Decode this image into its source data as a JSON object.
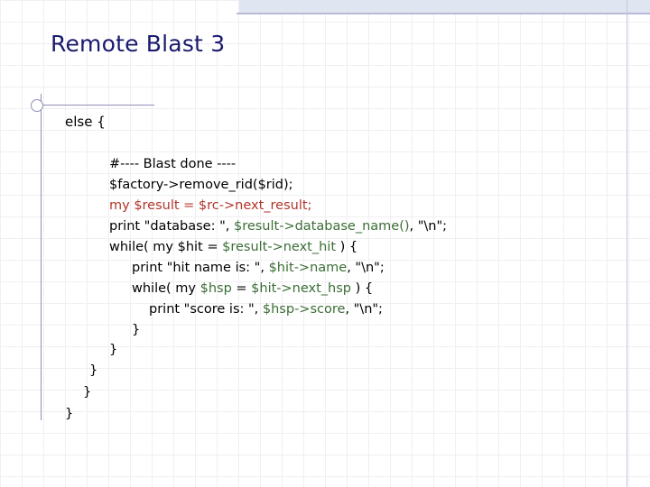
{
  "slide": {
    "title": "Remote Blast 3"
  },
  "code": {
    "else_open": "else {",
    "l1": "#---- Blast done ----",
    "l2": "$factory->remove_rid($rid);",
    "l3": "my $result = $rc->next_result;",
    "l4_a": "print \"database: \", ",
    "l4_b": "$result->database_name()",
    "l4_c": ", \"\\n\";",
    "l5_a": "while( my $hit = ",
    "l5_b": "$result->next_hit",
    "l5_c": " ) {",
    "l6_a": "print \"hit name is: \", ",
    "l6_b": "$hit->name",
    "l6_c": ", \"\\n\";",
    "l7_a": "while( my ",
    "l7_b": "$hsp",
    "l7_c": " = ",
    "l7_d": "$hit->next_hsp",
    "l7_e": " ) {",
    "l8_a": "print \"score is: \", ",
    "l8_b": "$hsp->score",
    "l8_c": ", \"\\n\";",
    "close_brace": "}"
  },
  "colors": {
    "title": "#1a1a6e",
    "keyword_red": "#b2352a",
    "var_green": "#3b6e35"
  }
}
